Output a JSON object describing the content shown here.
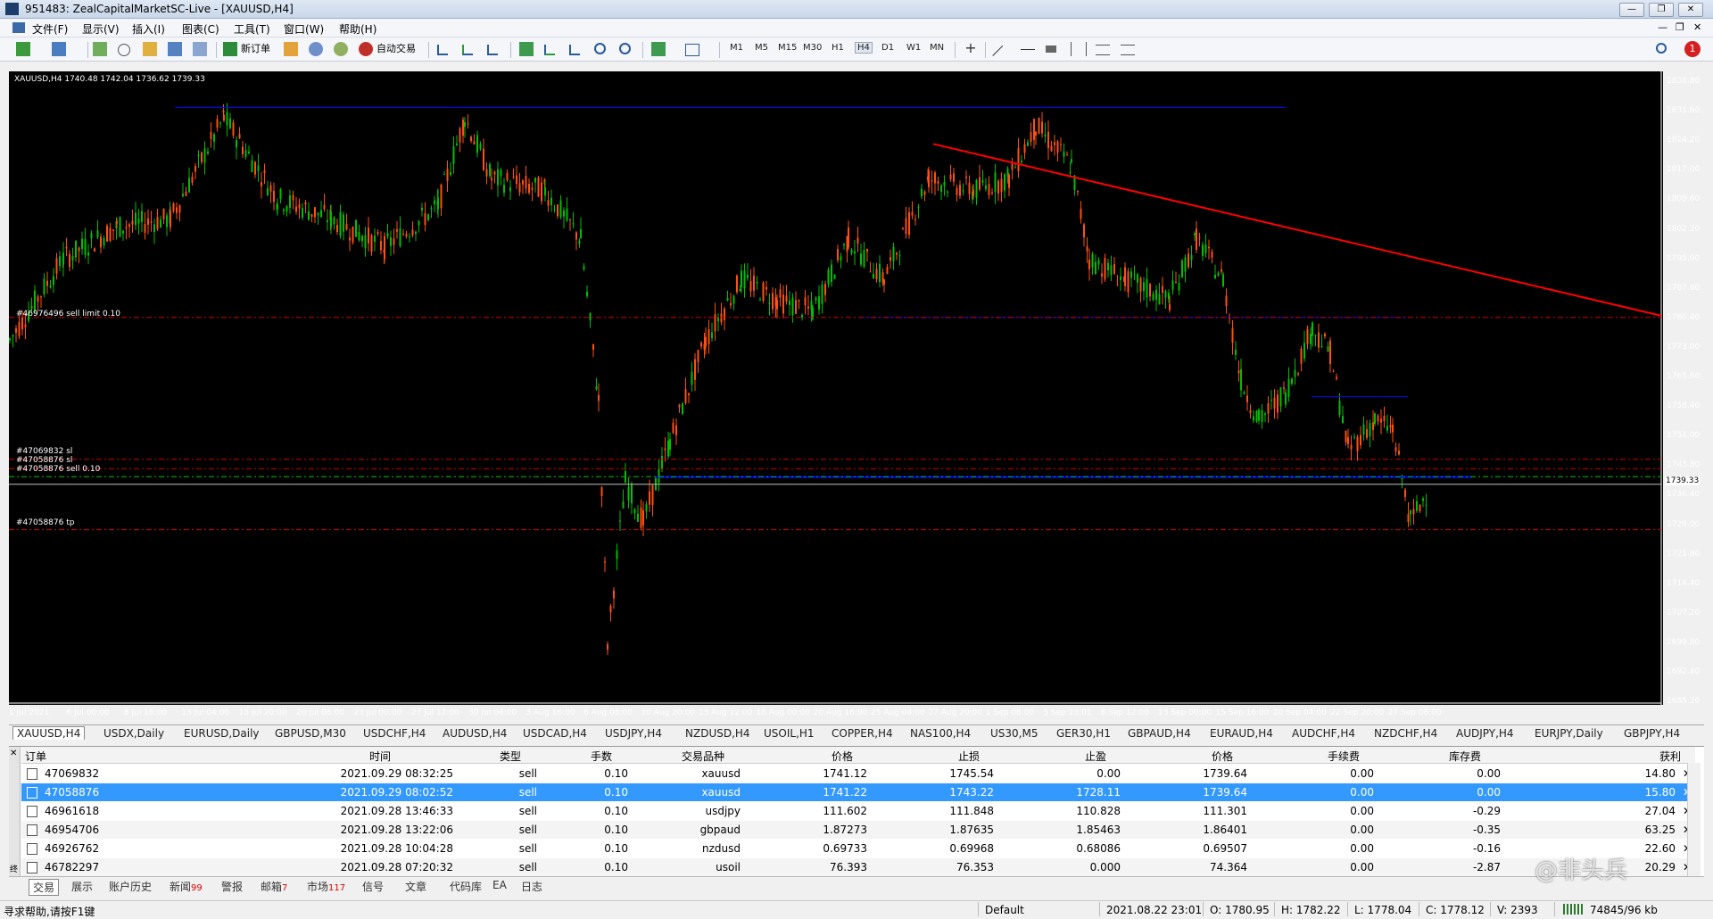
{
  "window": {
    "title": "951483: ZealCapitalMarketSC-Live - [XAUUSD,H4]",
    "buttons": [
      "—",
      "❐",
      "✕"
    ],
    "inner_buttons": [
      "—",
      "❐",
      "✕"
    ]
  },
  "menu": [
    "文件(F)",
    "显示(V)",
    "插入(I)",
    "图表(C)",
    "工具(T)",
    "窗口(W)",
    "帮助(H)"
  ],
  "toolbar": {
    "new_order": "新订单",
    "auto_trade": "自动交易",
    "timeframes": [
      "M1",
      "M5",
      "M15",
      "M30",
      "H1",
      "H4",
      "D1",
      "W1",
      "MN"
    ],
    "active_timeframe": "H4",
    "notification_count": "1"
  },
  "chart": {
    "header": "XAUUSD,H4  1740.48 1742.04 1736.62 1739.33",
    "price_labels": [
      "1838.80",
      "1831.60",
      "1824.20",
      "1817.00",
      "1809.60",
      "1802.20",
      "1795.00",
      "1787.60",
      "1780.40",
      "1773.00",
      "1765.60",
      "1758.40",
      "1751.00",
      "1743.80",
      "1736.40",
      "1729.00",
      "1721.80",
      "1714.40",
      "1707.20",
      "1699.80",
      "1692.40",
      "1685.20"
    ],
    "current_price": "1739.33",
    "date_labels": [
      "1 Jul 2021",
      "6 Jul 00:00",
      "8 Jul 16:00",
      "13 Jul 04:00",
      "15 Jul 20:00",
      "20 Jul 08:00",
      "23 Jul 00:00",
      "27 Jul 12:00",
      "30 Jul 04:00",
      "3 Aug 16:00",
      "6 Aug 08:00",
      "10 Aug 20:00",
      "13 Aug 12:00",
      "18 Aug 00:00",
      "20 Aug 16:00",
      "25 Aug 04:00",
      "27 Aug 20:00",
      "1 Sep 08:00",
      "5 Sep 23:01",
      "8 Sep 12:00",
      "13 Sep 00:00",
      "15 Sep 16:00",
      "20 Sep 04:00",
      "22 Sep 20:00",
      "27 Sep 08:00"
    ],
    "order_labels": {
      "sell_limit": "#46976496 sell limit 0.10",
      "sl1": "#47069832 sl",
      "sl2": "#47058876 sl",
      "sell": "#47058876 sell 0.10",
      "tp": "#47058876 tp"
    },
    "colors": {
      "bull": "#00c000",
      "bear": "#ff5010",
      "trend": "#ff0000",
      "support": "#0000ff",
      "order": "#d00000",
      "current": "#00c000"
    }
  },
  "symbol_tabs": [
    "XAUUSD,H4",
    "USDX,Daily",
    "EURUSD,Daily",
    "GBPUSD,M30",
    "USDCHF,H4",
    "AUDUSD,H4",
    "USDCAD,H4",
    "USDJPY,H4",
    "NZDUSD,H4",
    "USOIL,H1",
    "COPPER,H4",
    "NAS100,H4",
    "US30,M5",
    "GER30,H1",
    "GBPAUD,H4",
    "EURAUD,H4",
    "AUDCHF,H4",
    "NZDCHF,H4",
    "AUDJPY,H4",
    "EURJPY,Daily",
    "GBPJPY,H4"
  ],
  "terminal": {
    "headers": [
      "订单",
      "时间",
      "类型",
      "手数",
      "交易品种",
      "价格",
      "止损",
      "止盈",
      "价格",
      "手续费",
      "库存费",
      "获利"
    ],
    "rows": [
      {
        "order": "47069832",
        "time": "2021.09.29 08:32:25",
        "type": "sell",
        "lots": "0.10",
        "symbol": "xauusd",
        "price": "1741.12",
        "sl": "1745.54",
        "tp": "0.00",
        "cur": "1739.64",
        "fee": "0.00",
        "swap": "0.00",
        "profit": "14.80"
      },
      {
        "order": "47058876",
        "time": "2021.09.29 08:02:52",
        "type": "sell",
        "lots": "0.10",
        "symbol": "xauusd",
        "price": "1741.22",
        "sl": "1743.22",
        "tp": "1728.11",
        "cur": "1739.64",
        "fee": "0.00",
        "swap": "0.00",
        "profit": "15.80"
      },
      {
        "order": "46961618",
        "time": "2021.09.28 13:46:33",
        "type": "sell",
        "lots": "0.10",
        "symbol": "usdjpy",
        "price": "111.602",
        "sl": "111.848",
        "tp": "110.828",
        "cur": "111.301",
        "fee": "0.00",
        "swap": "-0.29",
        "profit": "27.04"
      },
      {
        "order": "46954706",
        "time": "2021.09.28 13:22:06",
        "type": "sell",
        "lots": "0.10",
        "symbol": "gbpaud",
        "price": "1.87273",
        "sl": "1.87635",
        "tp": "1.85463",
        "cur": "1.86401",
        "fee": "0.00",
        "swap": "-0.35",
        "profit": "63.25"
      },
      {
        "order": "46926762",
        "time": "2021.09.28 10:04:28",
        "type": "sell",
        "lots": "0.10",
        "symbol": "nzdusd",
        "price": "0.69733",
        "sl": "0.69968",
        "tp": "0.68086",
        "cur": "0.69507",
        "fee": "0.00",
        "swap": "-0.16",
        "profit": "22.60"
      },
      {
        "order": "46782297",
        "time": "2021.09.28 07:20:32",
        "type": "sell",
        "lots": "0.10",
        "symbol": "usoil",
        "price": "76.393",
        "sl": "76.353",
        "tp": "0.000",
        "cur": "74.364",
        "fee": "0.00",
        "swap": "-2.87",
        "profit": "20.29"
      }
    ]
  },
  "bottom_tabs": [
    {
      "label": "交易",
      "badge": ""
    },
    {
      "label": "展示",
      "badge": ""
    },
    {
      "label": "账户历史",
      "badge": ""
    },
    {
      "label": "新闻",
      "badge": "99"
    },
    {
      "label": "警报",
      "badge": ""
    },
    {
      "label": "邮箱",
      "badge": "7"
    },
    {
      "label": "市场",
      "badge": "117"
    },
    {
      "label": "信号",
      "badge": ""
    },
    {
      "label": "文章",
      "badge": ""
    },
    {
      "label": "代码库",
      "badge": ""
    },
    {
      "label": "EA",
      "badge": ""
    },
    {
      "label": "日志",
      "badge": ""
    }
  ],
  "side_label": "终端",
  "watermark": "@非头兵",
  "status": {
    "help": "寻求帮助,请按F1键",
    "profile": "Default",
    "datetime": "2021.08.22 23:01",
    "open": "O: 1780.95",
    "high": "H: 1782.22",
    "low": "L: 1778.04",
    "close": "C: 1778.12",
    "volume": "V: 2393",
    "traffic": "74845/96 kb"
  }
}
